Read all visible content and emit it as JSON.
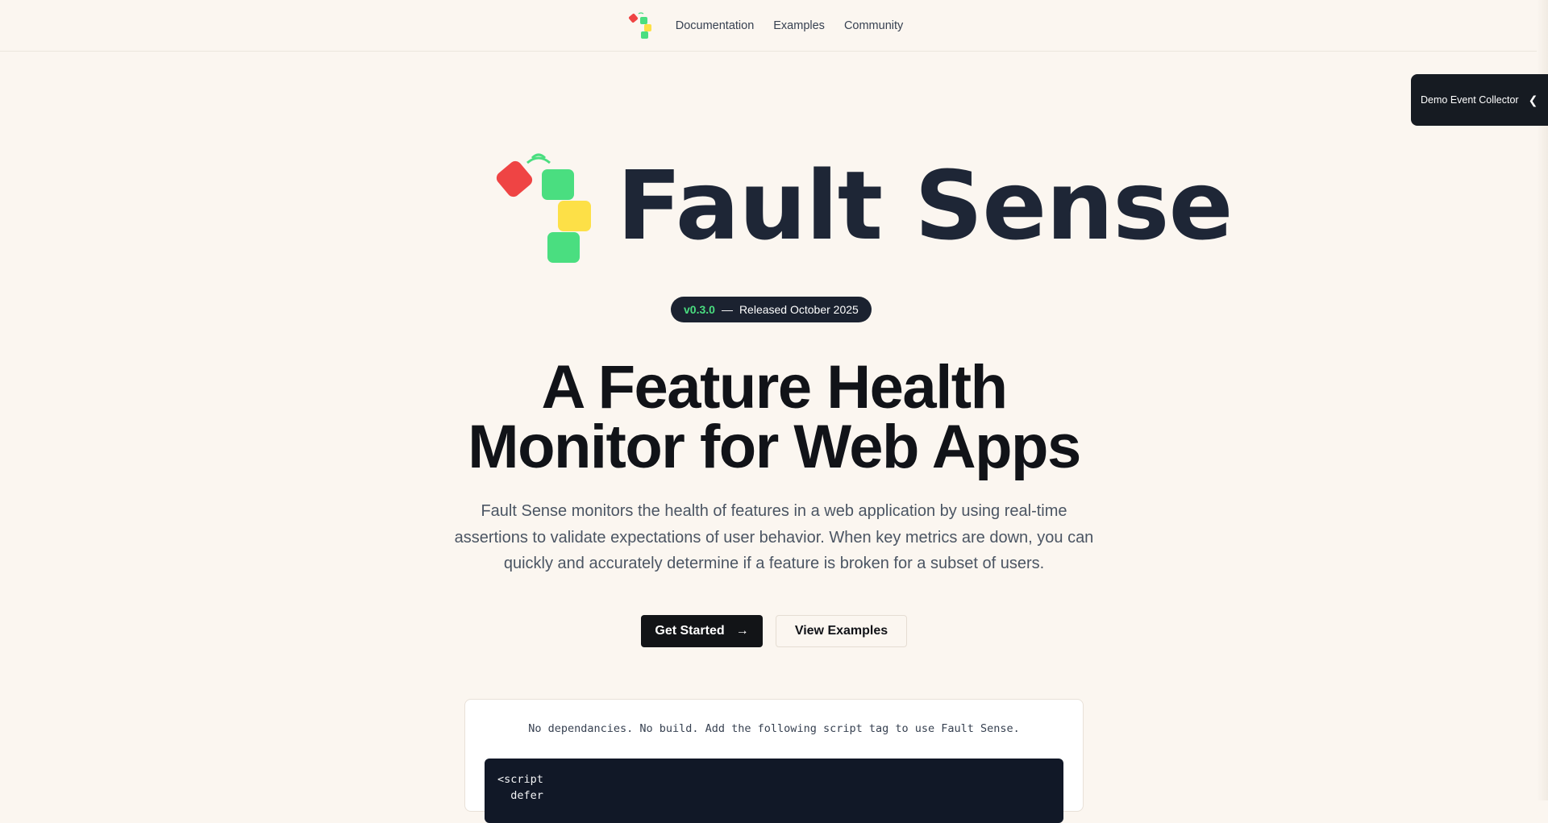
{
  "nav": {
    "links": [
      {
        "label": "Documentation"
      },
      {
        "label": "Examples"
      },
      {
        "label": "Community"
      }
    ]
  },
  "demo_collector": {
    "label": "Demo Event Collector",
    "icon": "chevron-left-icon"
  },
  "brand": {
    "name": "Fault Sense",
    "colors": {
      "red": "#ef4444",
      "green": "#4ade80",
      "yellow": "#fde047",
      "dark": "#1e2636"
    }
  },
  "version": {
    "number": "v0.3.0",
    "separator": "—",
    "released": "Released October 2025"
  },
  "hero": {
    "headline_line1": "A Feature Health",
    "headline_line2": "Monitor for Web Apps",
    "description": "Fault Sense monitors the health of features in a web application by using real-time assertions to validate expectations of user behavior. When key metrics are down, you can quickly and accurately determine if a feature is broken for a subset of users."
  },
  "buttons": {
    "get_started": "Get Started",
    "get_started_icon": "arrow-right-icon",
    "view_examples": "View Examples"
  },
  "install": {
    "note": "No dependancies. No build. Add the following script tag to use Fault Sense.",
    "code": "<script\n  defer"
  }
}
